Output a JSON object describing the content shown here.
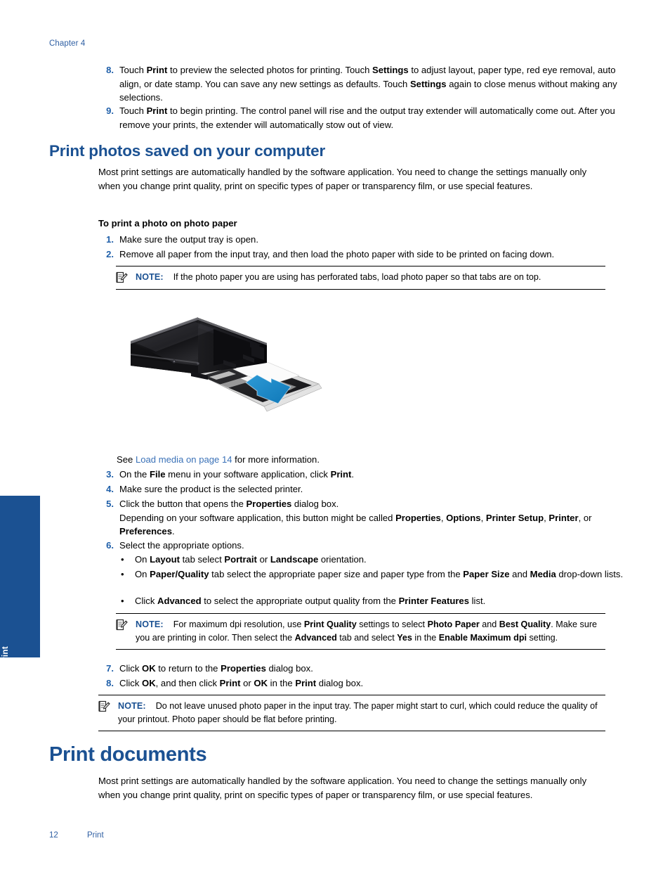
{
  "running_head": "Chapter 4",
  "side_tab": {
    "label": "Print",
    "color": "#1b5192"
  },
  "colors": {
    "heading_blue": "#1b5192",
    "number_blue": "#1f5fa9",
    "link_blue": "#3b72b8",
    "note_blue": "#1b5192"
  },
  "intro_steps": [
    {
      "number": "8.",
      "runs": [
        {
          "t": "Touch "
        },
        {
          "t": "Print",
          "b": true
        },
        {
          "t": " to preview the selected photos for printing. Touch "
        },
        {
          "t": "Settings",
          "b": true
        },
        {
          "t": " to adjust layout, paper type, red eye removal, auto align, or date stamp. You can save any new settings as defaults. Touch "
        },
        {
          "t": "Settings",
          "b": true
        },
        {
          "t": " again to close menus without making any selections."
        }
      ]
    },
    {
      "number": "9.",
      "runs": [
        {
          "t": "Touch "
        },
        {
          "t": "Print",
          "b": true
        },
        {
          "t": " to begin printing. The control panel will rise and the output tray extender will automatically come out. After you remove your prints, the extender will automatically stow out of view."
        }
      ]
    }
  ],
  "section": {
    "title": "Print photos saved on your computer",
    "intro": "Most print settings are automatically handled by the software application. You need to change the settings manually only when you change print quality, print on specific types of paper or transparency film, or use special features.",
    "procedure_title": "To print a photo on photo paper",
    "steps_1_2": [
      {
        "number": "1.",
        "runs": [
          {
            "t": "Make sure the output tray is open."
          }
        ]
      },
      {
        "number": "2.",
        "runs": [
          {
            "t": "Remove all paper from the input tray, and then load the photo paper with side to be printed on facing down."
          }
        ]
      }
    ],
    "note_1": {
      "label": "NOTE:",
      "runs": [
        {
          "t": "If the photo paper you are using has perforated tabs, load photo paper so that tabs are on top."
        }
      ]
    },
    "figure_caption_runs": [
      {
        "t": "See "
      },
      {
        "t": "Load media on page 14",
        "link": true
      },
      {
        "t": " for more information."
      }
    ],
    "steps_3_6": [
      {
        "number": "3.",
        "runs": [
          {
            "t": "On the "
          },
          {
            "t": "File",
            "b": true
          },
          {
            "t": " menu in your software application, click "
          },
          {
            "t": "Print",
            "b": true
          },
          {
            "t": "."
          }
        ]
      },
      {
        "number": "4.",
        "runs": [
          {
            "t": "Make sure the product is the selected printer."
          }
        ]
      },
      {
        "number": "5.",
        "runs": [
          {
            "t": "Click the button that opens the "
          },
          {
            "t": "Properties",
            "b": true
          },
          {
            "t": " dialog box."
          }
        ],
        "continuation": [
          {
            "t": "Depending on your software application, this button might be called "
          },
          {
            "t": "Properties",
            "b": true
          },
          {
            "t": ", "
          },
          {
            "t": "Options",
            "b": true
          },
          {
            "t": ", "
          },
          {
            "t": "Printer Setup",
            "b": true
          },
          {
            "t": ", "
          },
          {
            "t": "Printer",
            "b": true
          },
          {
            "t": ", or "
          },
          {
            "t": "Preferences",
            "b": true
          },
          {
            "t": "."
          }
        ]
      },
      {
        "number": "6.",
        "runs": [
          {
            "t": "Select the appropriate options."
          }
        ]
      }
    ],
    "bullets": [
      {
        "runs": [
          {
            "t": "On "
          },
          {
            "t": "Layout",
            "b": true
          },
          {
            "t": " tab select "
          },
          {
            "t": "Portrait",
            "b": true
          },
          {
            "t": " or "
          },
          {
            "t": "Landscape",
            "b": true
          },
          {
            "t": " orientation."
          }
        ]
      },
      {
        "runs": [
          {
            "t": "On "
          },
          {
            "t": "Paper/Quality",
            "b": true
          },
          {
            "t": " tab select the appropriate paper size and paper type from the "
          },
          {
            "t": "Paper Size",
            "b": true
          },
          {
            "t": " and "
          },
          {
            "t": "Media",
            "b": true
          },
          {
            "t": " drop-down lists."
          }
        ]
      },
      {
        "runs": [
          {
            "t": "Click "
          },
          {
            "t": "Advanced",
            "b": true
          },
          {
            "t": " to select the appropriate output quality from the "
          },
          {
            "t": "Printer Features",
            "b": true
          },
          {
            "t": " list."
          }
        ]
      }
    ],
    "note_2": {
      "label": "NOTE:",
      "runs": [
        {
          "t": "For maximum dpi resolution, use "
        },
        {
          "t": "Print Quality",
          "b": true
        },
        {
          "t": " settings to select "
        },
        {
          "t": "Photo Paper",
          "b": true
        },
        {
          "t": " and "
        },
        {
          "t": "Best Quality",
          "b": true
        },
        {
          "t": ". Make sure you are printing in color. Then select the "
        },
        {
          "t": "Advanced",
          "b": true
        },
        {
          "t": " tab and select "
        },
        {
          "t": "Yes",
          "b": true
        },
        {
          "t": " in the "
        },
        {
          "t": "Enable Maximum dpi",
          "b": true
        },
        {
          "t": " setting."
        }
      ]
    },
    "steps_7_8": [
      {
        "number": "7.",
        "runs": [
          {
            "t": "Click "
          },
          {
            "t": "OK",
            "b": true
          },
          {
            "t": " to return to the "
          },
          {
            "t": "Properties",
            "b": true
          },
          {
            "t": " dialog box."
          }
        ]
      },
      {
        "number": "8.",
        "runs": [
          {
            "t": "Click "
          },
          {
            "t": "OK",
            "b": true
          },
          {
            "t": ", and then click "
          },
          {
            "t": "Print",
            "b": true
          },
          {
            "t": " or "
          },
          {
            "t": "OK",
            "b": true
          },
          {
            "t": " in the "
          },
          {
            "t": "Print",
            "b": true
          },
          {
            "t": " dialog box."
          }
        ]
      }
    ],
    "note_3": {
      "label": "NOTE:",
      "runs": [
        {
          "t": "Do not leave unused photo paper in the input tray. The paper might start to curl, which could reduce the quality of your printout. Photo paper should be flat before printing."
        }
      ]
    }
  },
  "section2": {
    "title": "Print documents",
    "intro": "Most print settings are automatically handled by the software application. You need to change the settings manually only when you change print quality, print on specific types of paper or transparency film, or use special features."
  },
  "figure": {
    "name": "photo-printer-load-paper-illustration",
    "arrow_color": "#1b87c9"
  },
  "footer": {
    "page_number": "12",
    "section_label": "Print"
  }
}
